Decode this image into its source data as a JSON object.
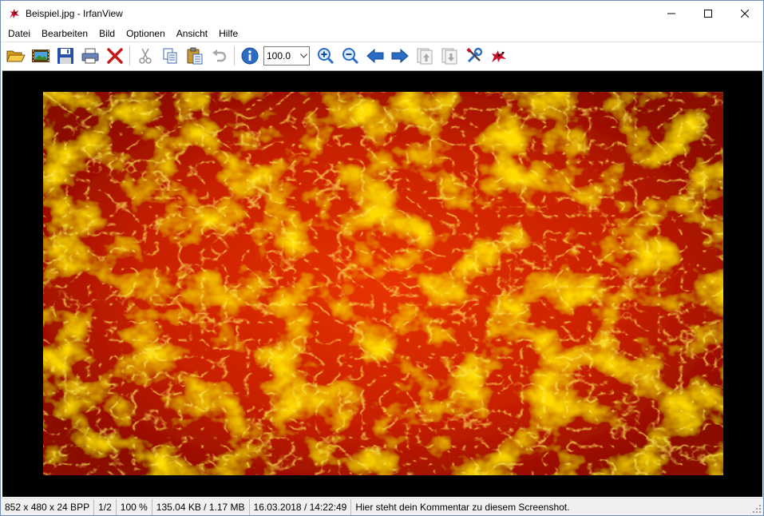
{
  "window": {
    "title": "Beispiel.jpg - IrfanView",
    "app_icon": "irfanview-cat-icon",
    "controls": [
      "minimize-icon",
      "maximize-icon",
      "close-icon"
    ]
  },
  "menu": {
    "items": [
      "Datei",
      "Bearbeiten",
      "Bild",
      "Optionen",
      "Ansicht",
      "Hilfe"
    ]
  },
  "toolbar": {
    "buttons_left": [
      "open-folder-icon",
      "slideshow-icon",
      "save-icon",
      "print-icon",
      "delete-icon"
    ],
    "buttons_edit": [
      "cut-icon",
      "copy-icon",
      "paste-icon",
      "undo-icon"
    ],
    "info_icon": "info-icon",
    "zoom_value": "100.0",
    "buttons_right": [
      "zoom-in-icon",
      "zoom-out-icon",
      "previous-icon",
      "next-icon",
      "page-up-icon",
      "page-down-icon",
      "settings-icon",
      "irfanview-cat-icon"
    ]
  },
  "colors": {
    "viewport_background": "#000000",
    "lava_dark": "#8a0800",
    "lava_mid": "#e02800",
    "lava_bright": "#ffb000",
    "toolbar_blue": "#2b6cc4"
  },
  "statusbar": {
    "dimensions": "852 x 480 x 24 BPP",
    "page": "1/2",
    "zoom": "100 %",
    "size": "135.04 KB / 1.17 MB",
    "datetime": "16.03.2018 / 14:22:49",
    "comment": "Hier steht dein Kommentar zu diesem Screenshot."
  }
}
